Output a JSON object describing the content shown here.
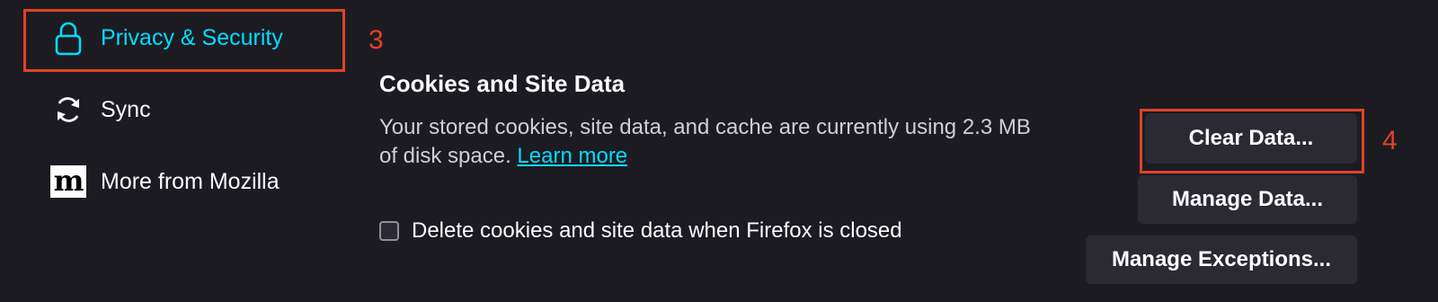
{
  "sidebar": {
    "items": [
      {
        "label": "Privacy & Security",
        "icon": "lock-icon",
        "selected": true
      },
      {
        "label": "Sync",
        "icon": "sync-icon",
        "selected": false
      },
      {
        "label": "More from Mozilla",
        "icon": "mozilla-logo-icon",
        "icon_text": "m",
        "selected": false
      }
    ]
  },
  "annotations": {
    "privacy_marker": "3",
    "clear_data_marker": "4"
  },
  "cookies": {
    "title": "Cookies and Site Data",
    "description_line1": "Your stored cookies, site data, and cache are currently using 2.3 MB",
    "description_line2": "of disk space.",
    "learn_more": "Learn more",
    "checkbox_label": "Delete cookies and site data when Firefox is closed",
    "checkbox_checked": false,
    "buttons": {
      "clear_data": "Clear Data...",
      "manage_data": "Manage Data...",
      "manage_exceptions": "Manage Exceptions..."
    }
  },
  "colors": {
    "background": "#1c1b22",
    "accent": "#00ddff",
    "annotation": "#e04227",
    "button_bg": "#2b2a33"
  }
}
